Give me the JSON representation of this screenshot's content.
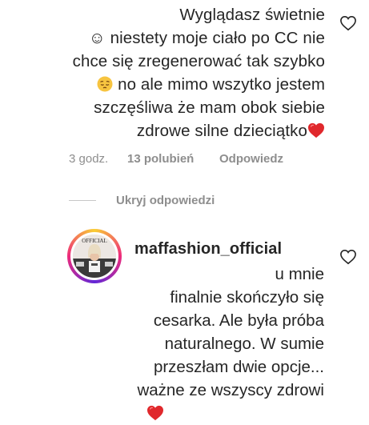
{
  "comment": {
    "lines": [
      "Wyglądasz świetnie",
      "☺ niestety moje ciało po CC nie",
      "chce się zregenerować tak szybko",
      "no ale mimo wszytko jestem",
      "szczęśliwa że mam obok siebie",
      "zdrowe silne dzieciątko"
    ],
    "time": "3 godz.",
    "likes": "13 polubień",
    "reply_label": "Odpowiedz",
    "emoji_pensive": "pensive-face-emoji",
    "emoji_heart": "red-heart-emoji"
  },
  "hide_replies_label": "Ukryj odpowiedzi",
  "reply": {
    "username": "maffashion_official",
    "avatar_text": "OFFICIAL",
    "lines": [
      "u mnie",
      "finalnie skończyło się",
      "cesarka. Ale była próba",
      "naturalnego. W sumie",
      "przeszłam dwie opcje...",
      "ważne ze wszyscy zdrowi"
    ],
    "emoji_heart": "red-heart-emoji"
  },
  "colors": {
    "text": "#262626",
    "secondary": "#8e8e8e",
    "heart_red": "#e0282c",
    "story_ring": [
      "#f9ce34",
      "#ee2a7b",
      "#6228d7"
    ]
  }
}
